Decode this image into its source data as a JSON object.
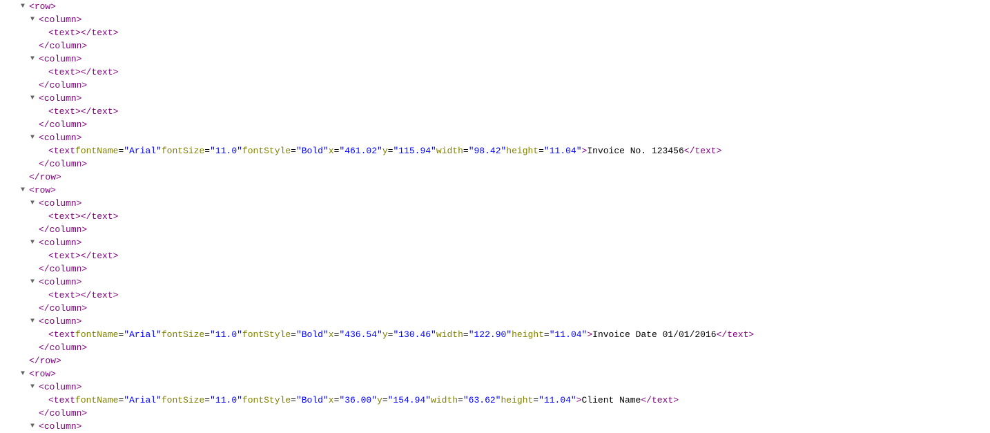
{
  "indentUnit": 14,
  "baseIndent": 30,
  "lines": [
    {
      "depth": 0,
      "caret": "▼",
      "tokens": [
        {
          "t": "punct",
          "v": "<"
        },
        {
          "t": "tag",
          "v": "row"
        },
        {
          "t": "punct",
          "v": ">"
        }
      ]
    },
    {
      "depth": 1,
      "caret": "▼",
      "tokens": [
        {
          "t": "punct",
          "v": "<"
        },
        {
          "t": "tag",
          "v": "column"
        },
        {
          "t": "punct",
          "v": ">"
        }
      ]
    },
    {
      "depth": 2,
      "caret": "",
      "tokens": [
        {
          "t": "punct",
          "v": "<"
        },
        {
          "t": "tag",
          "v": "text"
        },
        {
          "t": "punct",
          "v": ">"
        },
        {
          "t": "txt",
          "v": " "
        },
        {
          "t": "punct",
          "v": "</"
        },
        {
          "t": "tag",
          "v": "text"
        },
        {
          "t": "punct",
          "v": ">"
        }
      ]
    },
    {
      "depth": 1,
      "caret": "",
      "tokens": [
        {
          "t": "punct",
          "v": "</"
        },
        {
          "t": "tag",
          "v": "column"
        },
        {
          "t": "punct",
          "v": ">"
        }
      ]
    },
    {
      "depth": 1,
      "caret": "▼",
      "tokens": [
        {
          "t": "punct",
          "v": "<"
        },
        {
          "t": "tag",
          "v": "column"
        },
        {
          "t": "punct",
          "v": ">"
        }
      ]
    },
    {
      "depth": 2,
      "caret": "",
      "tokens": [
        {
          "t": "punct",
          "v": "<"
        },
        {
          "t": "tag",
          "v": "text"
        },
        {
          "t": "punct",
          "v": ">"
        },
        {
          "t": "txt",
          "v": " "
        },
        {
          "t": "punct",
          "v": "</"
        },
        {
          "t": "tag",
          "v": "text"
        },
        {
          "t": "punct",
          "v": ">"
        }
      ]
    },
    {
      "depth": 1,
      "caret": "",
      "tokens": [
        {
          "t": "punct",
          "v": "</"
        },
        {
          "t": "tag",
          "v": "column"
        },
        {
          "t": "punct",
          "v": ">"
        }
      ]
    },
    {
      "depth": 1,
      "caret": "▼",
      "tokens": [
        {
          "t": "punct",
          "v": "<"
        },
        {
          "t": "tag",
          "v": "column"
        },
        {
          "t": "punct",
          "v": ">"
        }
      ]
    },
    {
      "depth": 2,
      "caret": "",
      "tokens": [
        {
          "t": "punct",
          "v": "<"
        },
        {
          "t": "tag",
          "v": "text"
        },
        {
          "t": "punct",
          "v": ">"
        },
        {
          "t": "txt",
          "v": " "
        },
        {
          "t": "punct",
          "v": "</"
        },
        {
          "t": "tag",
          "v": "text"
        },
        {
          "t": "punct",
          "v": ">"
        }
      ]
    },
    {
      "depth": 1,
      "caret": "",
      "tokens": [
        {
          "t": "punct",
          "v": "</"
        },
        {
          "t": "tag",
          "v": "column"
        },
        {
          "t": "punct",
          "v": ">"
        }
      ]
    },
    {
      "depth": 1,
      "caret": "▼",
      "tokens": [
        {
          "t": "punct",
          "v": "<"
        },
        {
          "t": "tag",
          "v": "column"
        },
        {
          "t": "punct",
          "v": ">"
        }
      ]
    },
    {
      "depth": 2,
      "caret": "",
      "tokens": [
        {
          "t": "punct",
          "v": "<"
        },
        {
          "t": "tag",
          "v": "text"
        },
        {
          "t": "txt",
          "v": " "
        },
        {
          "t": "attr-name",
          "v": "fontName"
        },
        {
          "t": "eq",
          "v": "="
        },
        {
          "t": "attr-val",
          "v": "\"Arial\""
        },
        {
          "t": "txt",
          "v": " "
        },
        {
          "t": "attr-name",
          "v": "fontSize"
        },
        {
          "t": "eq",
          "v": "="
        },
        {
          "t": "attr-val",
          "v": "\"11.0\""
        },
        {
          "t": "txt",
          "v": " "
        },
        {
          "t": "attr-name",
          "v": "fontStyle"
        },
        {
          "t": "eq",
          "v": "="
        },
        {
          "t": "attr-val",
          "v": "\"Bold\""
        },
        {
          "t": "txt",
          "v": " "
        },
        {
          "t": "attr-name",
          "v": "x"
        },
        {
          "t": "eq",
          "v": "="
        },
        {
          "t": "attr-val",
          "v": "\"461.02\""
        },
        {
          "t": "txt",
          "v": " "
        },
        {
          "t": "attr-name",
          "v": "y"
        },
        {
          "t": "eq",
          "v": "="
        },
        {
          "t": "attr-val",
          "v": "\"115.94\""
        },
        {
          "t": "txt",
          "v": " "
        },
        {
          "t": "attr-name",
          "v": "width"
        },
        {
          "t": "eq",
          "v": "="
        },
        {
          "t": "attr-val",
          "v": "\"98.42\""
        },
        {
          "t": "txt",
          "v": " "
        },
        {
          "t": "attr-name",
          "v": "height"
        },
        {
          "t": "eq",
          "v": "="
        },
        {
          "t": "attr-val",
          "v": "\"11.04\""
        },
        {
          "t": "punct",
          "v": ">"
        },
        {
          "t": "txt",
          "v": "Invoice No. 123456"
        },
        {
          "t": "punct",
          "v": "</"
        },
        {
          "t": "tag",
          "v": "text"
        },
        {
          "t": "punct",
          "v": ">"
        }
      ]
    },
    {
      "depth": 1,
      "caret": "",
      "tokens": [
        {
          "t": "punct",
          "v": "</"
        },
        {
          "t": "tag",
          "v": "column"
        },
        {
          "t": "punct",
          "v": ">"
        }
      ]
    },
    {
      "depth": 0,
      "caret": "",
      "tokens": [
        {
          "t": "punct",
          "v": "</"
        },
        {
          "t": "tag",
          "v": "row"
        },
        {
          "t": "punct",
          "v": ">"
        }
      ]
    },
    {
      "depth": 0,
      "caret": "▼",
      "tokens": [
        {
          "t": "punct",
          "v": "<"
        },
        {
          "t": "tag",
          "v": "row"
        },
        {
          "t": "punct",
          "v": ">"
        }
      ]
    },
    {
      "depth": 1,
      "caret": "▼",
      "tokens": [
        {
          "t": "punct",
          "v": "<"
        },
        {
          "t": "tag",
          "v": "column"
        },
        {
          "t": "punct",
          "v": ">"
        }
      ]
    },
    {
      "depth": 2,
      "caret": "",
      "tokens": [
        {
          "t": "punct",
          "v": "<"
        },
        {
          "t": "tag",
          "v": "text"
        },
        {
          "t": "punct",
          "v": ">"
        },
        {
          "t": "txt",
          "v": " "
        },
        {
          "t": "punct",
          "v": "</"
        },
        {
          "t": "tag",
          "v": "text"
        },
        {
          "t": "punct",
          "v": ">"
        }
      ]
    },
    {
      "depth": 1,
      "caret": "",
      "tokens": [
        {
          "t": "punct",
          "v": "</"
        },
        {
          "t": "tag",
          "v": "column"
        },
        {
          "t": "punct",
          "v": ">"
        }
      ]
    },
    {
      "depth": 1,
      "caret": "▼",
      "tokens": [
        {
          "t": "punct",
          "v": "<"
        },
        {
          "t": "tag",
          "v": "column"
        },
        {
          "t": "punct",
          "v": ">"
        }
      ]
    },
    {
      "depth": 2,
      "caret": "",
      "tokens": [
        {
          "t": "punct",
          "v": "<"
        },
        {
          "t": "tag",
          "v": "text"
        },
        {
          "t": "punct",
          "v": ">"
        },
        {
          "t": "txt",
          "v": " "
        },
        {
          "t": "punct",
          "v": "</"
        },
        {
          "t": "tag",
          "v": "text"
        },
        {
          "t": "punct",
          "v": ">"
        }
      ]
    },
    {
      "depth": 1,
      "caret": "",
      "tokens": [
        {
          "t": "punct",
          "v": "</"
        },
        {
          "t": "tag",
          "v": "column"
        },
        {
          "t": "punct",
          "v": ">"
        }
      ]
    },
    {
      "depth": 1,
      "caret": "▼",
      "tokens": [
        {
          "t": "punct",
          "v": "<"
        },
        {
          "t": "tag",
          "v": "column"
        },
        {
          "t": "punct",
          "v": ">"
        }
      ]
    },
    {
      "depth": 2,
      "caret": "",
      "tokens": [
        {
          "t": "punct",
          "v": "<"
        },
        {
          "t": "tag",
          "v": "text"
        },
        {
          "t": "punct",
          "v": ">"
        },
        {
          "t": "txt",
          "v": " "
        },
        {
          "t": "punct",
          "v": "</"
        },
        {
          "t": "tag",
          "v": "text"
        },
        {
          "t": "punct",
          "v": ">"
        }
      ]
    },
    {
      "depth": 1,
      "caret": "",
      "tokens": [
        {
          "t": "punct",
          "v": "</"
        },
        {
          "t": "tag",
          "v": "column"
        },
        {
          "t": "punct",
          "v": ">"
        }
      ]
    },
    {
      "depth": 1,
      "caret": "▼",
      "tokens": [
        {
          "t": "punct",
          "v": "<"
        },
        {
          "t": "tag",
          "v": "column"
        },
        {
          "t": "punct",
          "v": ">"
        }
      ]
    },
    {
      "depth": 2,
      "caret": "",
      "tokens": [
        {
          "t": "punct",
          "v": "<"
        },
        {
          "t": "tag",
          "v": "text"
        },
        {
          "t": "txt",
          "v": " "
        },
        {
          "t": "attr-name",
          "v": "fontName"
        },
        {
          "t": "eq",
          "v": "="
        },
        {
          "t": "attr-val",
          "v": "\"Arial\""
        },
        {
          "t": "txt",
          "v": " "
        },
        {
          "t": "attr-name",
          "v": "fontSize"
        },
        {
          "t": "eq",
          "v": "="
        },
        {
          "t": "attr-val",
          "v": "\"11.0\""
        },
        {
          "t": "txt",
          "v": " "
        },
        {
          "t": "attr-name",
          "v": "fontStyle"
        },
        {
          "t": "eq",
          "v": "="
        },
        {
          "t": "attr-val",
          "v": "\"Bold\""
        },
        {
          "t": "txt",
          "v": " "
        },
        {
          "t": "attr-name",
          "v": "x"
        },
        {
          "t": "eq",
          "v": "="
        },
        {
          "t": "attr-val",
          "v": "\"436.54\""
        },
        {
          "t": "txt",
          "v": " "
        },
        {
          "t": "attr-name",
          "v": "y"
        },
        {
          "t": "eq",
          "v": "="
        },
        {
          "t": "attr-val",
          "v": "\"130.46\""
        },
        {
          "t": "txt",
          "v": " "
        },
        {
          "t": "attr-name",
          "v": "width"
        },
        {
          "t": "eq",
          "v": "="
        },
        {
          "t": "attr-val",
          "v": "\"122.90\""
        },
        {
          "t": "txt",
          "v": " "
        },
        {
          "t": "attr-name",
          "v": "height"
        },
        {
          "t": "eq",
          "v": "="
        },
        {
          "t": "attr-val",
          "v": "\"11.04\""
        },
        {
          "t": "punct",
          "v": ">"
        },
        {
          "t": "txt",
          "v": "Invoice Date 01/01/2016"
        },
        {
          "t": "punct",
          "v": "</"
        },
        {
          "t": "tag",
          "v": "text"
        },
        {
          "t": "punct",
          "v": ">"
        }
      ]
    },
    {
      "depth": 1,
      "caret": "",
      "tokens": [
        {
          "t": "punct",
          "v": "</"
        },
        {
          "t": "tag",
          "v": "column"
        },
        {
          "t": "punct",
          "v": ">"
        }
      ]
    },
    {
      "depth": 0,
      "caret": "",
      "tokens": [
        {
          "t": "punct",
          "v": "</"
        },
        {
          "t": "tag",
          "v": "row"
        },
        {
          "t": "punct",
          "v": ">"
        }
      ]
    },
    {
      "depth": 0,
      "caret": "▼",
      "tokens": [
        {
          "t": "punct",
          "v": "<"
        },
        {
          "t": "tag",
          "v": "row"
        },
        {
          "t": "punct",
          "v": ">"
        }
      ]
    },
    {
      "depth": 1,
      "caret": "▼",
      "tokens": [
        {
          "t": "punct",
          "v": "<"
        },
        {
          "t": "tag",
          "v": "column"
        },
        {
          "t": "punct",
          "v": ">"
        }
      ]
    },
    {
      "depth": 2,
      "caret": "",
      "tokens": [
        {
          "t": "punct",
          "v": "<"
        },
        {
          "t": "tag",
          "v": "text"
        },
        {
          "t": "txt",
          "v": " "
        },
        {
          "t": "attr-name",
          "v": "fontName"
        },
        {
          "t": "eq",
          "v": "="
        },
        {
          "t": "attr-val",
          "v": "\"Arial\""
        },
        {
          "t": "txt",
          "v": " "
        },
        {
          "t": "attr-name",
          "v": "fontSize"
        },
        {
          "t": "eq",
          "v": "="
        },
        {
          "t": "attr-val",
          "v": "\"11.0\""
        },
        {
          "t": "txt",
          "v": " "
        },
        {
          "t": "attr-name",
          "v": "fontStyle"
        },
        {
          "t": "eq",
          "v": "="
        },
        {
          "t": "attr-val",
          "v": "\"Bold\""
        },
        {
          "t": "txt",
          "v": " "
        },
        {
          "t": "attr-name",
          "v": "x"
        },
        {
          "t": "eq",
          "v": "="
        },
        {
          "t": "attr-val",
          "v": "\"36.00\""
        },
        {
          "t": "txt",
          "v": " "
        },
        {
          "t": "attr-name",
          "v": "y"
        },
        {
          "t": "eq",
          "v": "="
        },
        {
          "t": "attr-val",
          "v": "\"154.94\""
        },
        {
          "t": "txt",
          "v": " "
        },
        {
          "t": "attr-name",
          "v": "width"
        },
        {
          "t": "eq",
          "v": "="
        },
        {
          "t": "attr-val",
          "v": "\"63.62\""
        },
        {
          "t": "txt",
          "v": " "
        },
        {
          "t": "attr-name",
          "v": "height"
        },
        {
          "t": "eq",
          "v": "="
        },
        {
          "t": "attr-val",
          "v": "\"11.04\""
        },
        {
          "t": "punct",
          "v": ">"
        },
        {
          "t": "txt",
          "v": "Client Name"
        },
        {
          "t": "punct",
          "v": "</"
        },
        {
          "t": "tag",
          "v": "text"
        },
        {
          "t": "punct",
          "v": ">"
        }
      ]
    },
    {
      "depth": 1,
      "caret": "",
      "tokens": [
        {
          "t": "punct",
          "v": "</"
        },
        {
          "t": "tag",
          "v": "column"
        },
        {
          "t": "punct",
          "v": ">"
        }
      ]
    },
    {
      "depth": 1,
      "caret": "▼",
      "tokens": [
        {
          "t": "punct",
          "v": "<"
        },
        {
          "t": "tag",
          "v": "column"
        },
        {
          "t": "punct",
          "v": ">"
        }
      ]
    }
  ]
}
